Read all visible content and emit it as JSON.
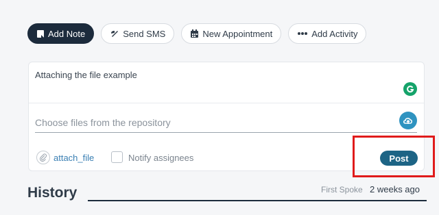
{
  "tabs": [
    {
      "label": "Add Note",
      "icon": "note-icon",
      "active": true
    },
    {
      "label": "Send SMS",
      "icon": "sms-icon",
      "active": false
    },
    {
      "label": "New Appointment",
      "icon": "calendar-icon",
      "active": false
    },
    {
      "label": "Add Activity",
      "icon": "dots-icon",
      "active": false
    }
  ],
  "note": {
    "text": "Attaching the file example"
  },
  "file_picker": {
    "placeholder": "Choose files from the repository"
  },
  "attach": {
    "label": "attach_file"
  },
  "notify": {
    "label": "Notify assignees",
    "checked": false
  },
  "post": {
    "label": "Post"
  },
  "history": {
    "title": "History",
    "first_spoke_label": "First Spoke",
    "first_spoke_value": "2 weeks ago"
  },
  "colors": {
    "active_tab": "#1c2b3c",
    "post_button": "#1d6485",
    "highlight": "#e01b1b",
    "grammarly": "#15a36a",
    "cloud": "#2f93c0",
    "link": "#3a7fb3"
  }
}
